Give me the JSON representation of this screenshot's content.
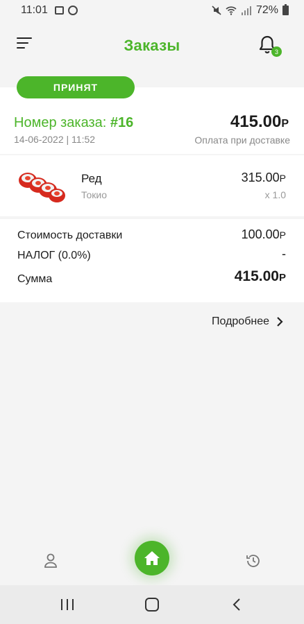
{
  "status_bar": {
    "time": "11:01",
    "battery": "72%"
  },
  "header": {
    "title": "Заказы",
    "notification_count": "3"
  },
  "order": {
    "status": "ПРИНЯТ",
    "number_label": "Номер заказа:",
    "number": "#16",
    "date": "14-06-2022 | 11:52",
    "total": "415.00",
    "currency": "Р",
    "payment_method": "Оплата при доставке"
  },
  "items": [
    {
      "name": "Ред",
      "restaurant": "Токио",
      "price": "315.00",
      "currency": "Р",
      "quantity": "x 1.0"
    }
  ],
  "summary": {
    "delivery_label": "Стоимость доставки",
    "delivery_value": "100.00",
    "tax_label": "НАЛОГ (0.0%)",
    "tax_value": "-",
    "total_label": "Сумма",
    "total_value": "415.00",
    "currency": "Р"
  },
  "details_link": "Подробнее",
  "colors": {
    "accent": "#4cb52a",
    "muted": "#888888",
    "background": "#f4f4f4"
  },
  "bottom_nav": {
    "items": [
      "person-icon",
      "home-icon",
      "history-icon"
    ]
  }
}
